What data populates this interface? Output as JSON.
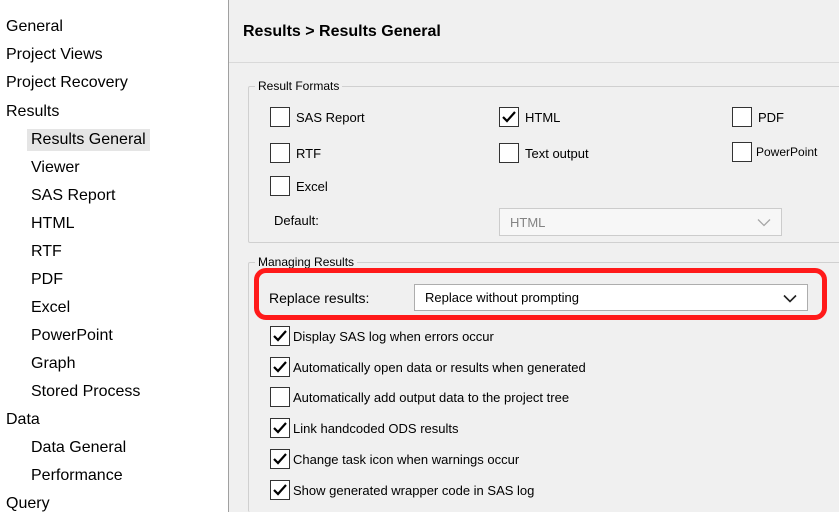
{
  "sidebar": {
    "items": [
      {
        "label": "General"
      },
      {
        "label": "Project Views"
      },
      {
        "label": "Project Recovery"
      },
      {
        "label": "Results"
      },
      {
        "label": "Results General"
      },
      {
        "label": "Viewer"
      },
      {
        "label": "SAS Report"
      },
      {
        "label": "HTML"
      },
      {
        "label": "RTF"
      },
      {
        "label": "PDF"
      },
      {
        "label": "Excel"
      },
      {
        "label": "PowerPoint"
      },
      {
        "label": "Graph"
      },
      {
        "label": "Stored Process"
      },
      {
        "label": "Data"
      },
      {
        "label": "Data General"
      },
      {
        "label": "Performance"
      },
      {
        "label": "Query"
      }
    ],
    "selected": "Results General"
  },
  "main": {
    "title": "Results > Results General",
    "result_formats": {
      "legend": "Result Formats",
      "options": [
        {
          "label": "SAS Report",
          "checked": false
        },
        {
          "label": "HTML",
          "checked": true
        },
        {
          "label": "PDF",
          "checked": false
        },
        {
          "label": "RTF",
          "checked": false
        },
        {
          "label": "Text output",
          "checked": false
        },
        {
          "label": "PowerPoint",
          "checked": false
        },
        {
          "label": "Excel",
          "checked": false
        }
      ],
      "default_label": "Default:",
      "default_value": "HTML"
    },
    "managing_results": {
      "legend": "Managing Results",
      "replace_label": "Replace results:",
      "replace_value": "Replace without prompting",
      "options": [
        {
          "label": "Display SAS log when errors occur",
          "checked": true
        },
        {
          "label": "Automatically open data or results when generated",
          "checked": true
        },
        {
          "label": "Automatically add output data to the project tree",
          "checked": false
        },
        {
          "label": "Link handcoded ODS results",
          "checked": true
        },
        {
          "label": "Change task icon when warnings occur",
          "checked": true
        },
        {
          "label": "Show generated wrapper code in SAS log",
          "checked": true
        }
      ]
    }
  },
  "colors": {
    "highlight": "#ff1a1a"
  }
}
